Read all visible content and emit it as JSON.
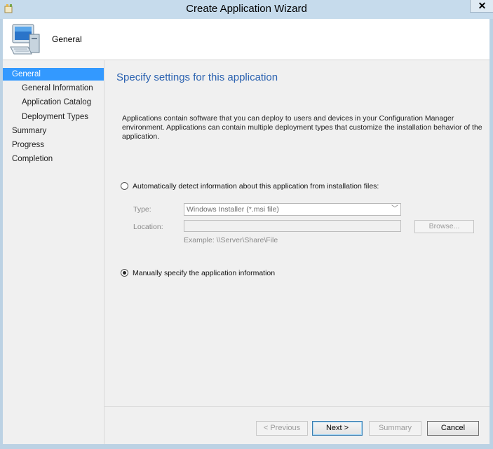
{
  "window": {
    "title": "Create Application Wizard",
    "close_label": "✕"
  },
  "header": {
    "title": "General"
  },
  "nav": {
    "items": [
      {
        "label": "General",
        "active": true
      },
      {
        "label": "General Information"
      },
      {
        "label": "Application Catalog"
      },
      {
        "label": "Deployment Types"
      },
      {
        "label": "Summary"
      },
      {
        "label": "Progress"
      },
      {
        "label": "Completion"
      }
    ]
  },
  "main": {
    "heading": "Specify settings for this application",
    "description": "Applications contain software that you can deploy to users and devices in your Configuration Manager environment. Applications can contain multiple deployment types that customize the installation behavior of the application.",
    "auto_detect": {
      "label": "Automatically detect information about this application from installation files:",
      "checked": false,
      "type_label": "Type:",
      "type_value": "Windows Installer (*.msi file)",
      "location_label": "Location:",
      "location_value": "",
      "browse_label": "Browse...",
      "example": "Example: \\\\Server\\Share\\File"
    },
    "manual": {
      "label": "Manually specify the application information",
      "checked": true
    }
  },
  "footer": {
    "previous_label": "< Previous",
    "next_label": "Next >",
    "summary_label": "Summary",
    "cancel_label": "Cancel"
  },
  "icons": {
    "app": "wizard-app-icon",
    "header": "computer-icon",
    "close": "close-icon",
    "dropdown": "chevron-down-icon"
  }
}
